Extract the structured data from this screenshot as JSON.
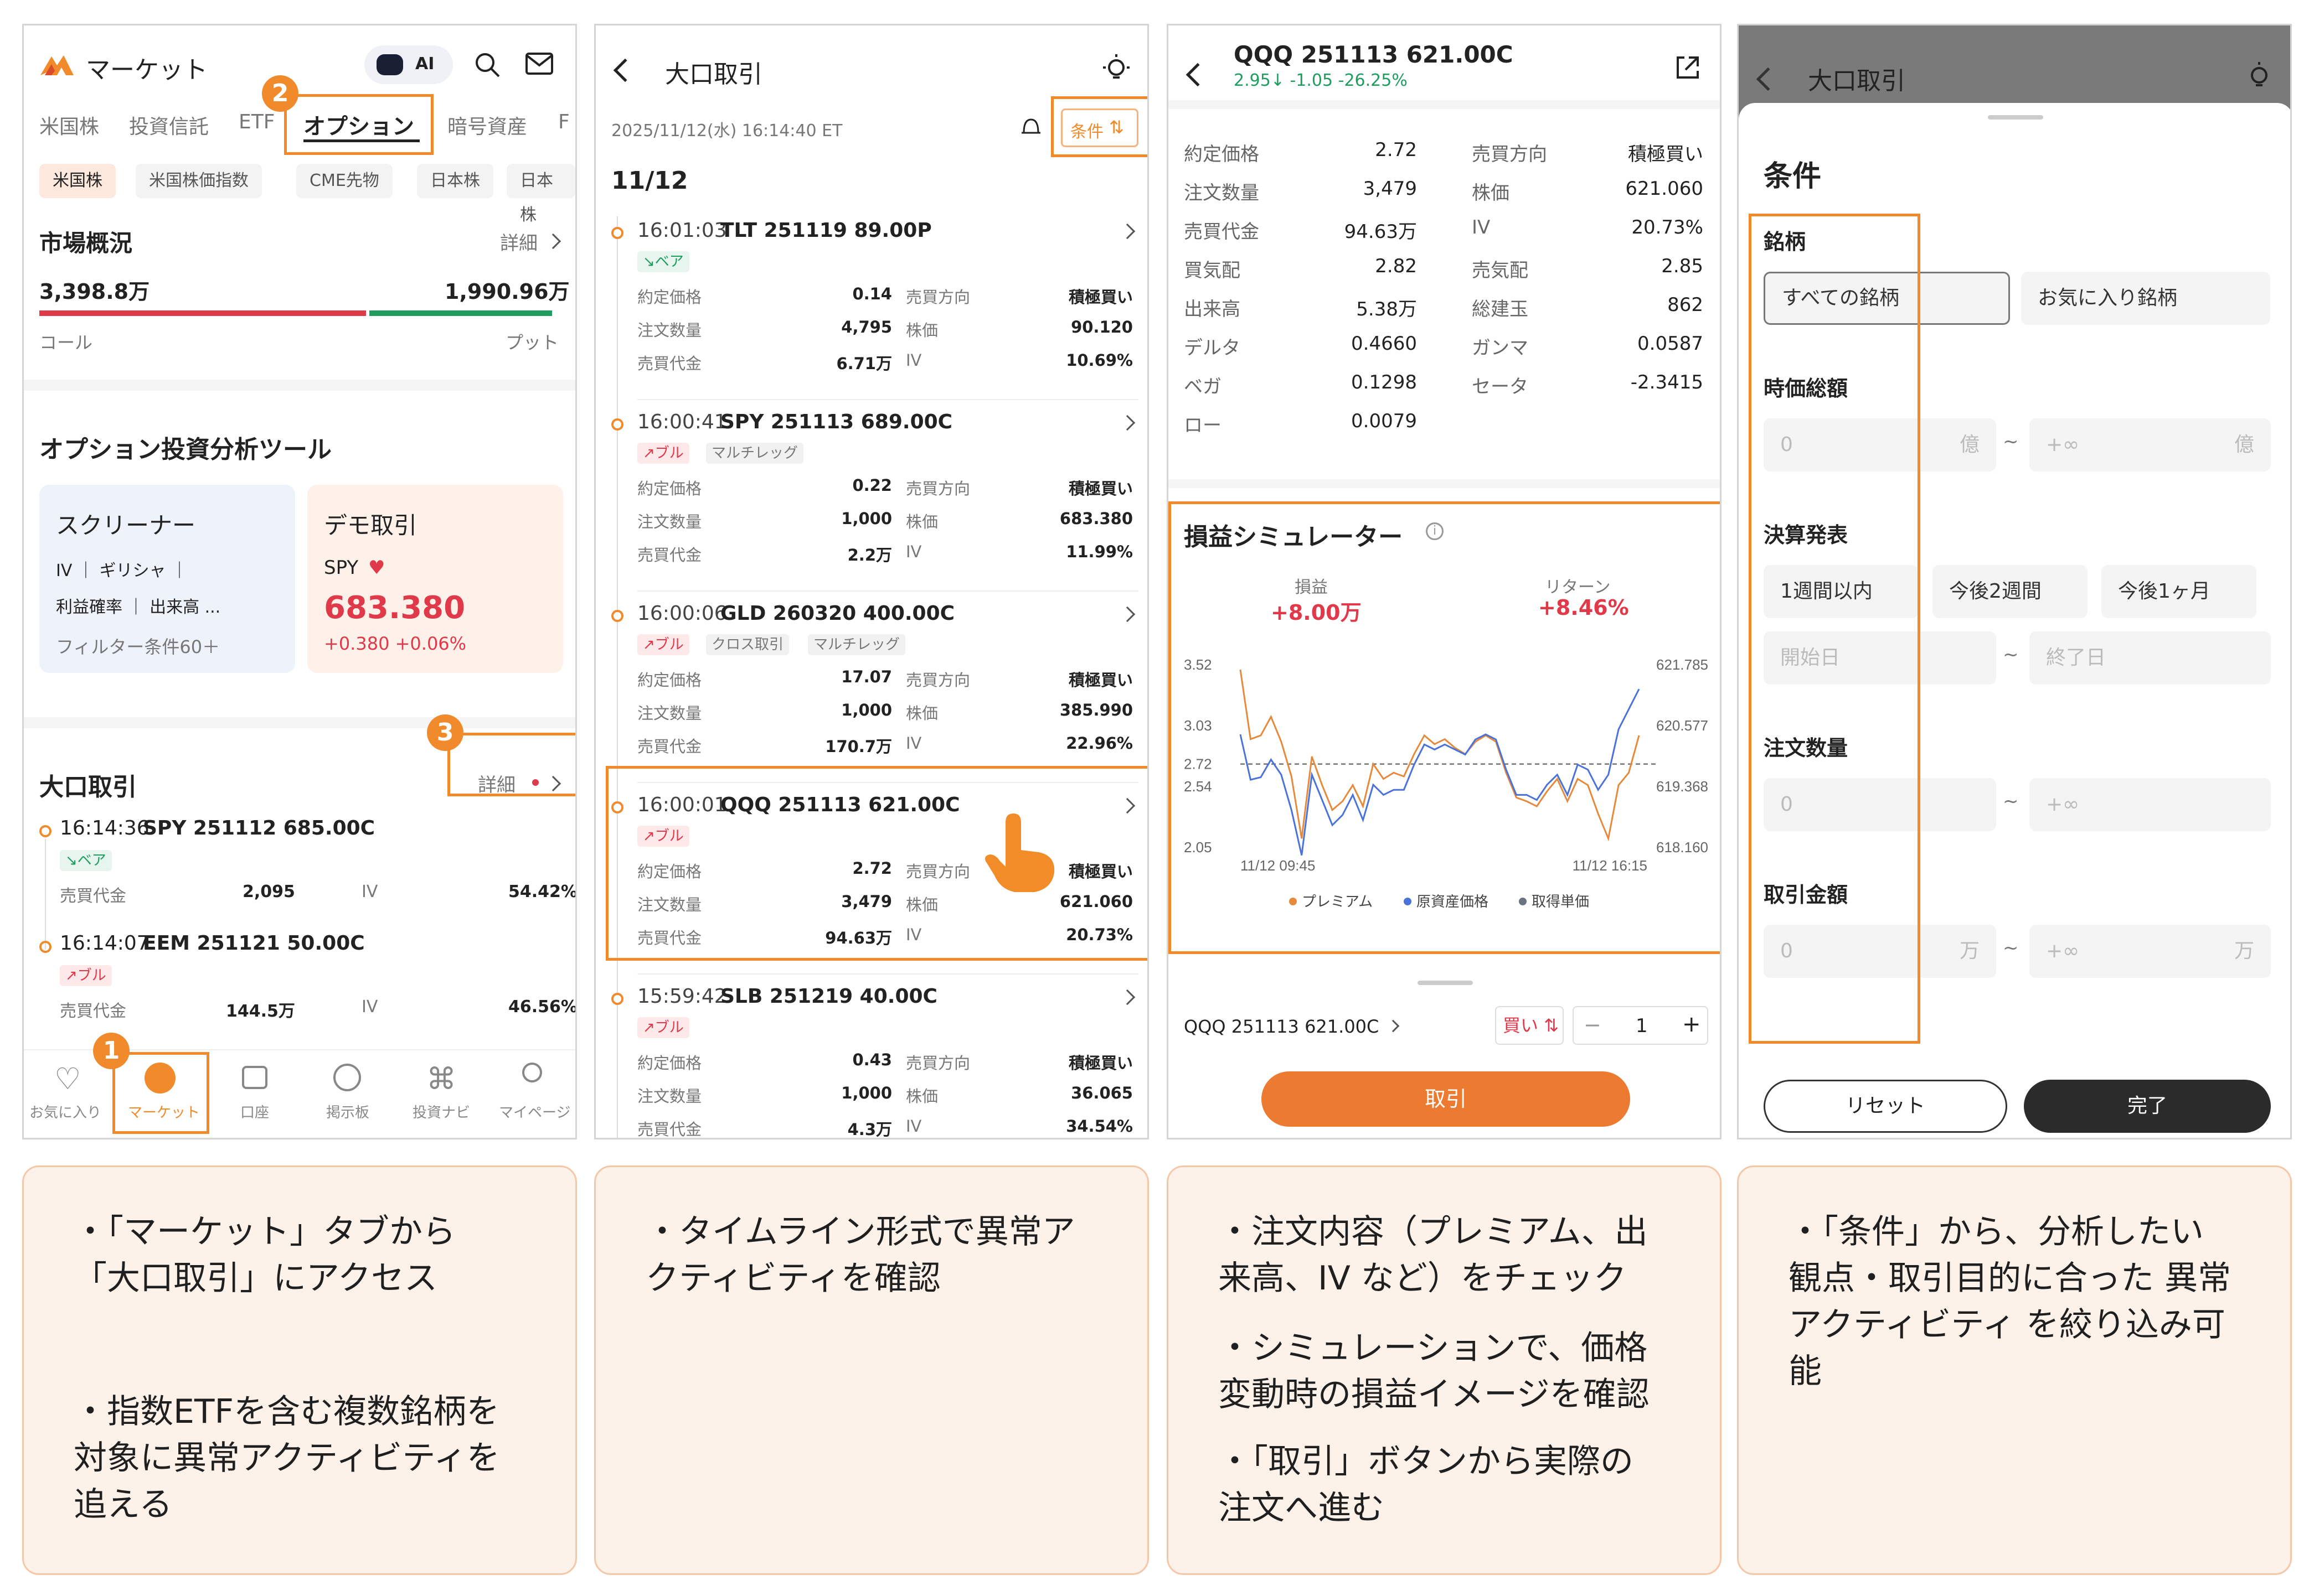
{
  "p1": {
    "title": "マーケット",
    "ai": "AI",
    "tabs": [
      "米国株",
      "投資信託",
      "ETF",
      "オプション",
      "暗号資産",
      "F"
    ],
    "chips": [
      "米国株",
      "米国株価指数",
      "CME先物",
      "日本株",
      "日本株"
    ],
    "overview_title": "市場概況",
    "detail": "詳細",
    "call_amount": "3,398.8万",
    "put_amount": "1,990.96万",
    "call_label": "コール",
    "put_label": "プット",
    "tools_title": "オプション投資分析ツール",
    "screener": {
      "title": "スクリーナー",
      "l1": "IV ｜ ギリシャ ｜",
      "l2": "利益確率 ｜ 出来高 ...",
      "l3": "フィルター条件60＋"
    },
    "demo": {
      "title": "デモ取引",
      "ticker": "SPY",
      "price": "683.380",
      "change": "+0.380  +0.06%"
    },
    "block_title": "大口取引",
    "block_detail": "詳細",
    "trades": [
      {
        "time": "16:14:36",
        "name": "SPY 251112 685.00C",
        "tag": "ベア",
        "tagtype": "bear",
        "label": "売買代金",
        "value": "2,095",
        "iv_label": "IV",
        "iv": "54.42%"
      },
      {
        "time": "16:14:07",
        "name": "EEM 251121 50.00C",
        "tag": "ブル",
        "tagtype": "bull",
        "label": "売買代金",
        "value": "144.5万",
        "iv_label": "IV",
        "iv": "46.56%"
      }
    ],
    "nav": [
      "お気に入り",
      "マーケット",
      "口座",
      "掲示板",
      "投資ナビ",
      "マイページ"
    ],
    "steps": [
      "1",
      "2",
      "3"
    ]
  },
  "p2": {
    "title": "大口取引",
    "datetime": "2025/11/12(水) 16:14:40 ET",
    "cond": "条件",
    "date": "11/12",
    "cards": [
      {
        "time": "16:01:03",
        "name": "TLT 251119 89.00P",
        "tags": [
          "ベア"
        ],
        "rows": [
          [
            "約定価格",
            "0.14",
            "売買方向",
            "積極買い"
          ],
          [
            "注文数量",
            "4,795",
            "株価",
            "90.120"
          ],
          [
            "売買代金",
            "6.71万",
            "IV",
            "10.69%"
          ]
        ]
      },
      {
        "time": "16:00:41",
        "name": "SPY 251113 689.00C",
        "tags": [
          "ブル",
          "マルチレッグ"
        ],
        "rows": [
          [
            "約定価格",
            "0.22",
            "売買方向",
            "積極買い"
          ],
          [
            "注文数量",
            "1,000",
            "株価",
            "683.380"
          ],
          [
            "売買代金",
            "2.2万",
            "IV",
            "11.99%"
          ]
        ]
      },
      {
        "time": "16:00:06",
        "name": "GLD 260320 400.00C",
        "tags": [
          "ブル",
          "クロス取引",
          "マルチレッグ"
        ],
        "rows": [
          [
            "約定価格",
            "17.07",
            "売買方向",
            "積極買い"
          ],
          [
            "注文数量",
            "1,000",
            "株価",
            "385.990"
          ],
          [
            "売買代金",
            "170.7万",
            "IV",
            "22.96%"
          ]
        ]
      },
      {
        "time": "16:00:01",
        "name": "QQQ 251113 621.00C",
        "tags": [
          "ブル"
        ],
        "rows": [
          [
            "約定価格",
            "2.72",
            "売買方向",
            "積極買い"
          ],
          [
            "注文数量",
            "3,479",
            "株価",
            "621.060"
          ],
          [
            "売買代金",
            "94.63万",
            "IV",
            "20.73%"
          ]
        ]
      },
      {
        "time": "15:59:42",
        "name": "SLB 251219 40.00C",
        "tags": [
          "ブル"
        ],
        "rows": [
          [
            "約定価格",
            "0.43",
            "売買方向",
            "積極買い"
          ],
          [
            "注文数量",
            "1,000",
            "株価",
            "36.065"
          ],
          [
            "売買代金",
            "4.3万",
            "IV",
            "34.54%"
          ]
        ]
      }
    ]
  },
  "p3": {
    "title": "QQQ 251113 621.00C",
    "sub": "2.95↓ -1.05 -26.25%",
    "left": [
      [
        "約定価格",
        "2.72"
      ],
      [
        "注文数量",
        "3,479"
      ],
      [
        "売買代金",
        "94.63万"
      ],
      [
        "買気配",
        "2.82"
      ],
      [
        "出来高",
        "5.38万"
      ],
      [
        "デルタ",
        "0.4660"
      ],
      [
        "ベガ",
        "0.1298"
      ],
      [
        "ロー",
        "0.0079"
      ]
    ],
    "right": [
      [
        "売買方向",
        "積極買い"
      ],
      [
        "株価",
        "621.060"
      ],
      [
        "IV",
        "20.73%"
      ],
      [
        "売気配",
        "2.85"
      ],
      [
        "総建玉",
        "862"
      ],
      [
        "ガンマ",
        "0.0587"
      ],
      [
        "セータ",
        "-2.3415"
      ]
    ],
    "sim_title": "損益シミュレーター",
    "pl_label": "損益",
    "pl": "+8.00万",
    "ret_label": "リターン",
    "ret": "+8.46%",
    "order_name": "QQQ 251113 621.00C",
    "buy": "買い",
    "qty": "1",
    "trade_btn": "取引"
  },
  "chart_data": {
    "type": "line",
    "x": [
      "11/12 09:45",
      "",
      "",
      "",
      "",
      "",
      "",
      "",
      "",
      "",
      "",
      "",
      "",
      "",
      "",
      "",
      "",
      "",
      "",
      "",
      "",
      "",
      "",
      "",
      "",
      "",
      "",
      "",
      "",
      "",
      "",
      "",
      "",
      "",
      "",
      "",
      "",
      "",
      "",
      "11/12 16:15"
    ],
    "left_ticks": [
      "3.52",
      "3.03",
      "2.72",
      "2.54",
      "2.05"
    ],
    "right_ticks": [
      "621.785",
      "620.577",
      "619.368",
      "618.160"
    ],
    "x_ticks": [
      "11/12 09:45",
      "11/12 16:15"
    ],
    "ylim": [
      2.05,
      3.52
    ],
    "y2lim": [
      618.16,
      621.785
    ],
    "ref_line": 2.72,
    "series": [
      {
        "name": "プレミアム",
        "color": "#e58a3c",
        "values": [
          3.48,
          2.92,
          2.95,
          3.1,
          2.9,
          2.62,
          2.12,
          2.78,
          2.55,
          2.35,
          2.42,
          2.55,
          2.38,
          2.72,
          2.6,
          2.65,
          2.62,
          2.8,
          2.95,
          2.88,
          2.92,
          2.85,
          2.8,
          2.9,
          2.95,
          2.9,
          2.65,
          2.45,
          2.42,
          2.38,
          2.5,
          2.6,
          2.42,
          2.6,
          2.55,
          2.32,
          2.12,
          2.55,
          2.65,
          2.95
        ]
      },
      {
        "name": "原資産価格",
        "color": "#4a72d8",
        "values": [
          620.4,
          619.5,
          619.55,
          619.9,
          619.6,
          618.9,
          618.0,
          619.6,
          619.1,
          618.6,
          618.8,
          619.2,
          618.7,
          619.4,
          619.2,
          619.3,
          619.3,
          619.8,
          620.2,
          620.1,
          620.2,
          620.1,
          620.0,
          620.3,
          620.4,
          620.3,
          619.7,
          619.2,
          619.2,
          619.1,
          619.4,
          619.6,
          619.2,
          619.8,
          619.7,
          619.3,
          619.6,
          620.5,
          620.9,
          621.3
        ]
      },
      {
        "name": "取得単価",
        "color": "#6b7280",
        "values": [
          2.72,
          2.72
        ]
      }
    ]
  },
  "p4": {
    "title": "大口取引",
    "sheet_title": "条件",
    "s1": "銘柄",
    "opt_all": "すべての銘柄",
    "opt_fav": "お気に入り銘柄",
    "s2": "時価総額",
    "mc_min": "0",
    "mc_unit": "億",
    "mc_max": "+∞",
    "tilde": "~",
    "s3": "決算発表",
    "e1": "1週間以内",
    "e2": "今後2週間",
    "e3": "今後1ヶ月",
    "start": "開始日",
    "end": "終了日",
    "s4": "注文数量",
    "q_min": "0",
    "q_max": "+∞",
    "s5": "取引金額",
    "a_min": "0",
    "a_unit": "万",
    "a_max": "+∞",
    "reset": "リセット",
    "done": "完了"
  },
  "captions": {
    "c1a": "・「マーケット」タブから\n「大口取引」にアクセス",
    "c1b": "・指数ETFを含む複数銘柄を\n対象に異常アクティビティを\n追える",
    "c2": "・タイムライン形式で異常ア\nクティビティを確認",
    "c3a": "・注文内容（プレミアム、出\n来高、IV など）をチェック",
    "c3b": "・シミュレーションで、価格\n変動時の損益イメージを確認",
    "c3c": "・「取引」ボタンから実際の\n注文へ進む",
    "c4": "・「条件」から、分析したい\n観点・取引目的に合った 異常\nアクティビティ を絞り込み可\n能"
  },
  "colors": {
    "accent": "#f08a2a",
    "red": "#e0394a",
    "green": "#1f9d5f"
  }
}
